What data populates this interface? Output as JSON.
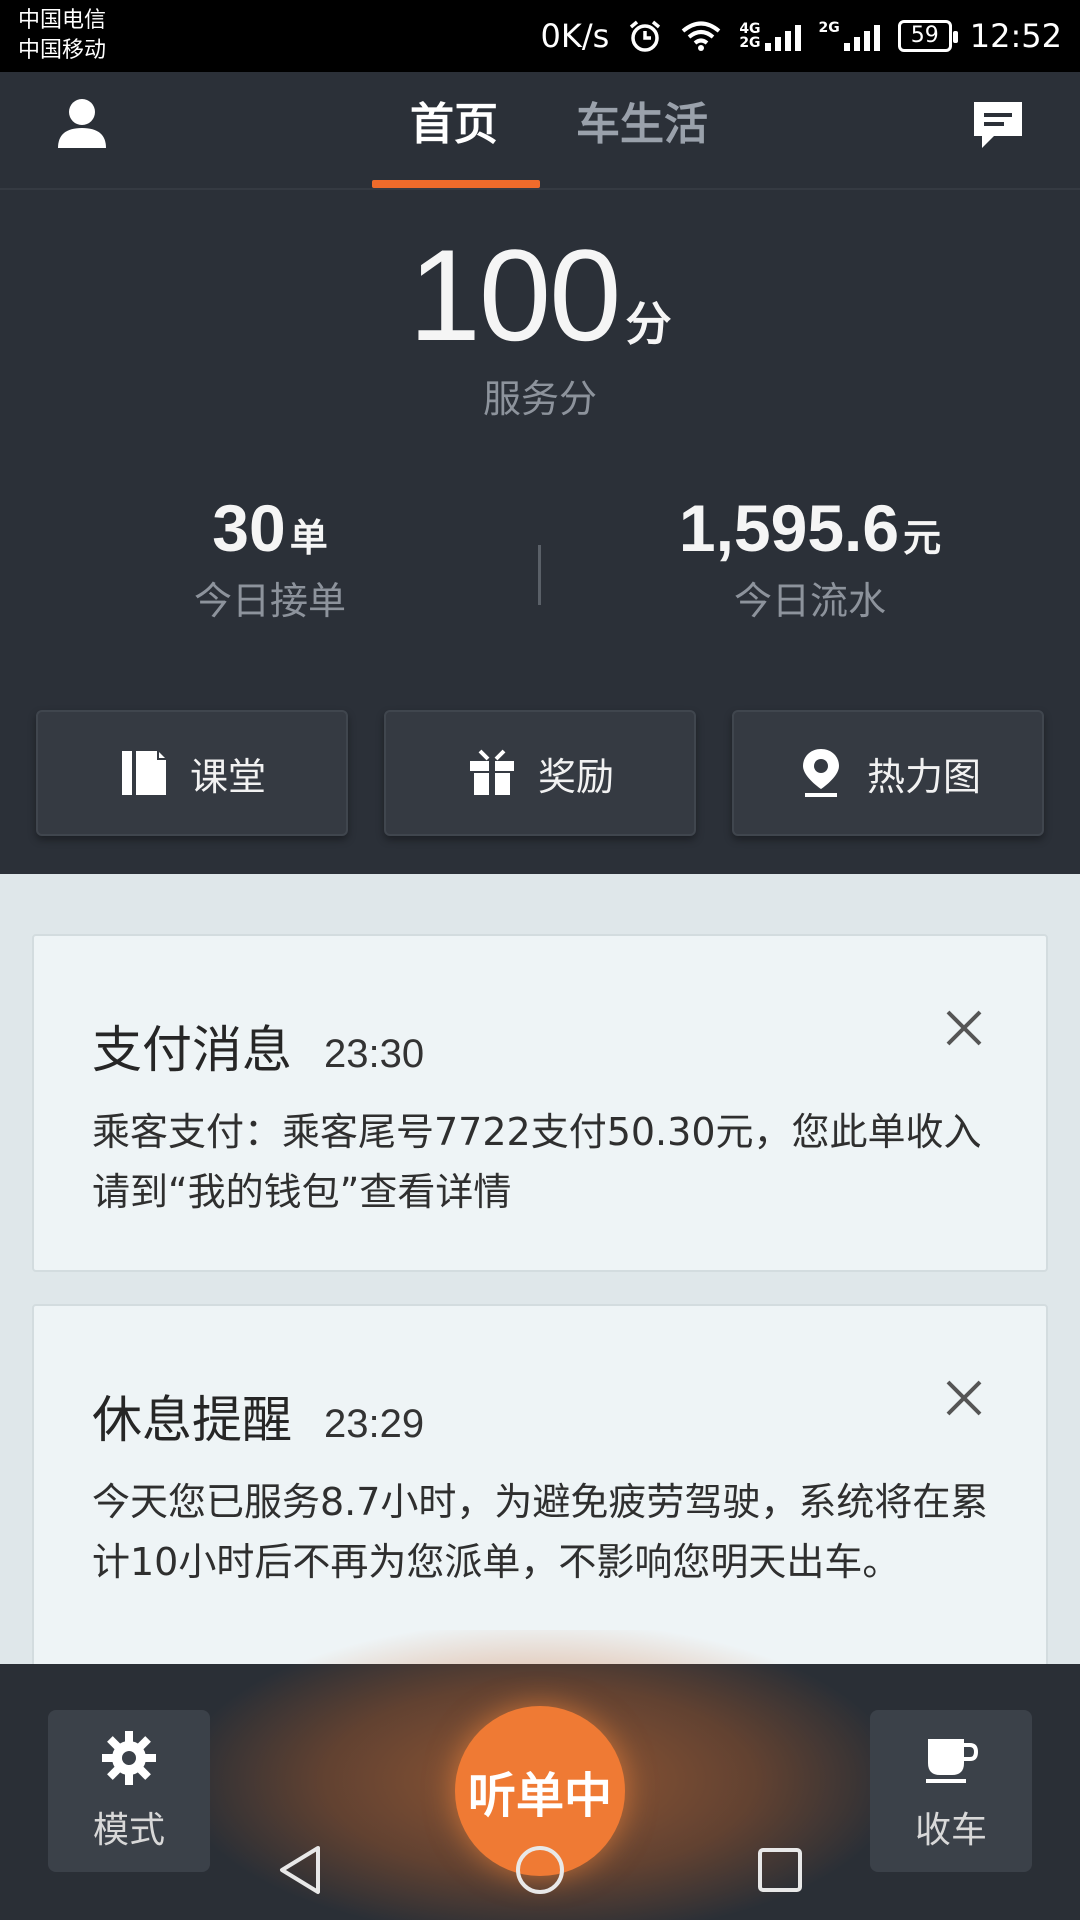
{
  "statusbar": {
    "carrier1": "中国电信",
    "carrier2": "中国移动",
    "speed": "0K/s",
    "net1": "4G",
    "net1b": "2G",
    "net2": "2G",
    "battery": "59",
    "time": "12:52"
  },
  "header": {
    "tabs": [
      {
        "label": "首页",
        "active": true
      },
      {
        "label": "车生活",
        "active": false
      }
    ],
    "accent_color": "#ef6b2b"
  },
  "score": {
    "value": "100",
    "unit": "分",
    "label": "服务分"
  },
  "stats": {
    "orders": {
      "value": "30",
      "unit": "单",
      "label": "今日接单"
    },
    "revenue": {
      "value": "1,595.6",
      "unit": "元",
      "label": "今日流水"
    }
  },
  "actions": [
    {
      "label": "课堂",
      "icon": "book-icon"
    },
    {
      "label": "奖励",
      "icon": "gift-icon"
    },
    {
      "label": "热力图",
      "icon": "location-pin-icon"
    }
  ],
  "messages": [
    {
      "title": "支付消息",
      "time": "23:30",
      "body": "乘客支付：乘客尾号7722支付50.30元，您此单收入请到“我的钱包”查看详情"
    },
    {
      "title": "休息提醒",
      "time": "23:29",
      "body": "今天您已服务8.7小时，为避免疲劳驾驶，系统将在累计10小时后不再为您派单，不影响您明天出车。"
    }
  ],
  "bottom": {
    "mode_label": "模式",
    "listen_label": "听单中",
    "close_shift_label": "收车",
    "listen_color": "#ef7a34"
  }
}
